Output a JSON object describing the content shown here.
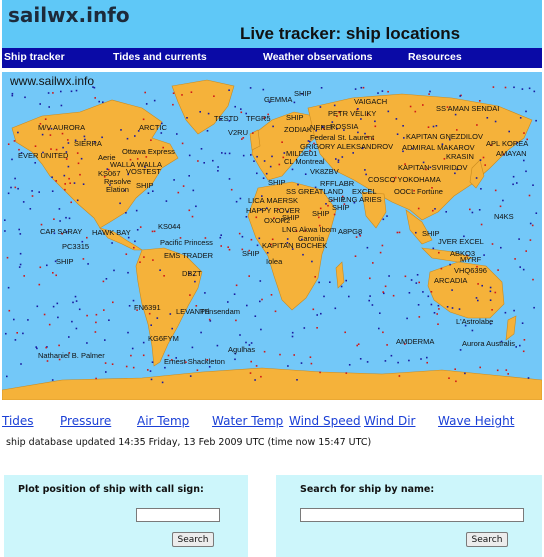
{
  "header": {
    "logo_text": "sailwx.info",
    "title": "Live tracker:  ship locations"
  },
  "nav": {
    "items": [
      {
        "label": "Ship tracker"
      },
      {
        "label": "Tides and currents"
      },
      {
        "label": "Weather observations"
      },
      {
        "label": "Resources"
      }
    ]
  },
  "map": {
    "watermark": "www.sailwx.info",
    "colors": {
      "ocean": "#73c8f8",
      "land": "#f5b23a"
    },
    "ship_labels": [
      {
        "text": "GEMMA"
      },
      {
        "text": "SHIP"
      },
      {
        "text": "VAIGACH"
      },
      {
        "text": "SS AMAN SENDAI"
      },
      {
        "text": "TESTD"
      },
      {
        "text": "TFGR5"
      },
      {
        "text": "SHIP"
      },
      {
        "text": "PETR VELIKY"
      },
      {
        "text": "M/V AURORA"
      },
      {
        "text": "ARCTIC"
      },
      {
        "text": "V2RU"
      },
      {
        "text": "ZODIAK"
      },
      {
        "text": "NEREI"
      },
      {
        "text": "ROSSIA"
      },
      {
        "text": "Federal St. Laurent"
      },
      {
        "text": "KAPITAN GNEZDILOV"
      },
      {
        "text": "SIERRA"
      },
      {
        "text": "GRIGORY ALEKSANDROV"
      },
      {
        "text": "ADMIRAL MAKAROV"
      },
      {
        "text": "APL KOREA"
      },
      {
        "text": "EVER UNITED"
      },
      {
        "text": "Ottawa Express"
      },
      {
        "text": "MILDE01"
      },
      {
        "text": "KRASIN"
      },
      {
        "text": "AMAYAN"
      },
      {
        "text": "Aerie"
      },
      {
        "text": "WALLA WALLA"
      },
      {
        "text": "CL Montreal"
      },
      {
        "text": "KAPITAN SVIRIDOV"
      },
      {
        "text": "VOSTEST"
      },
      {
        "text": "VK8ZBV"
      },
      {
        "text": "COSCO YOKOHAMA"
      },
      {
        "text": "KS067"
      },
      {
        "text": "Resolve"
      },
      {
        "text": "RFFLABR"
      },
      {
        "text": "OOCL Fortune"
      },
      {
        "text": "Elation"
      },
      {
        "text": "SHIP"
      },
      {
        "text": "SHIP"
      },
      {
        "text": "SS GREATLAND"
      },
      {
        "text": "EXCEL"
      },
      {
        "text": "SHIP"
      },
      {
        "text": "LNG ARIES"
      },
      {
        "text": "LICA MAERSK"
      },
      {
        "text": "SHIP"
      },
      {
        "text": "SHIP"
      },
      {
        "text": "HAPPY ROVER"
      },
      {
        "text": "SHIP"
      },
      {
        "text": "N4KS"
      },
      {
        "text": "CAP SARAY"
      },
      {
        "text": "HAWK BAY"
      },
      {
        "text": "KS044"
      },
      {
        "text": "OXOR2"
      },
      {
        "text": "LNG Akwa Ibom"
      },
      {
        "text": "A8PG8"
      },
      {
        "text": "PC3315"
      },
      {
        "text": "Pacific Princess"
      },
      {
        "text": "Caronia"
      },
      {
        "text": "SHIP"
      },
      {
        "text": "JVER EXCEL"
      },
      {
        "text": "KAPITAN BOCHEK"
      },
      {
        "text": "ABKO3"
      },
      {
        "text": "SHIP"
      },
      {
        "text": "EMS TRADER"
      },
      {
        "text": "SHIP"
      },
      {
        "text": "Iolea"
      },
      {
        "text": "MYRF"
      },
      {
        "text": "VHQ6396"
      },
      {
        "text": "DBZT"
      },
      {
        "text": "ARCADIA"
      },
      {
        "text": "FN6391"
      },
      {
        "text": "LEVANTE"
      },
      {
        "text": "Prinsendam"
      },
      {
        "text": "L'Astrolabe"
      },
      {
        "text": "KG6FYM"
      },
      {
        "text": "AMDERMA"
      },
      {
        "text": "Aurora Australis"
      },
      {
        "text": "Agulhas"
      },
      {
        "text": "Nathaniel B. Palmer"
      },
      {
        "text": "Ernest Shackleton"
      }
    ]
  },
  "layers": [
    {
      "label": "Tides"
    },
    {
      "label": "Pressure"
    },
    {
      "label": "Air Temp"
    },
    {
      "label": "Water Temp"
    },
    {
      "label": "Wind Speed"
    },
    {
      "label": "Wind Dir"
    },
    {
      "label": "Wave Height"
    }
  ],
  "status": {
    "update_text": "ship database updated 14:35 Friday, 13 Feb 2009 UTC (time now 15:47 UTC)"
  },
  "callsign_form": {
    "title": "Plot position of ship with call sign:",
    "value": "",
    "button": "Search"
  },
  "name_form": {
    "title": "Search for ship by name:",
    "value": "",
    "button": "Search"
  }
}
